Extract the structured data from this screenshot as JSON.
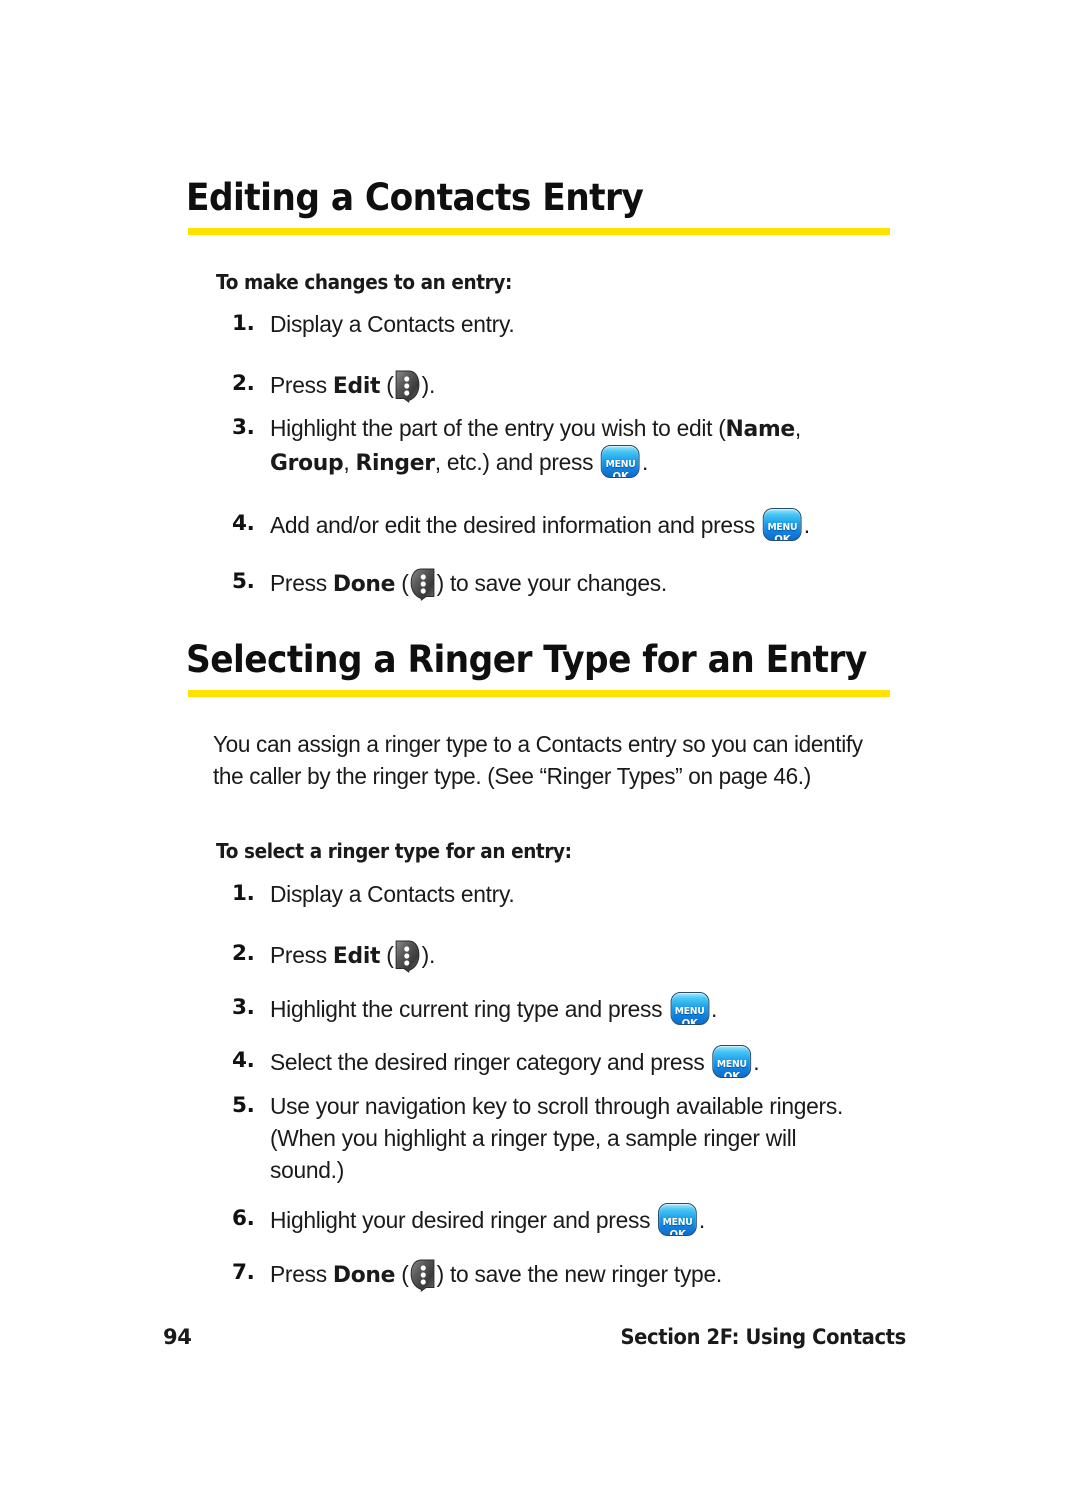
{
  "page": {
    "number": "94",
    "section_footer": "Section 2F: Using Contacts",
    "accent_rule_color": "#ffe200",
    "background_color": "#ffffff"
  },
  "icons": {
    "softkey_edit": "softkey-edit-icon",
    "softkey_done": "softkey-done-icon",
    "menu_ok_top": "MENU",
    "menu_ok_bottom": "OK"
  },
  "sections": [
    {
      "heading": "Editing a Contacts Entry",
      "subheading": "To make changes to an entry:",
      "steps": [
        {
          "num": "1.",
          "text": "Display a Contacts entry."
        },
        {
          "num": "2.",
          "text": "Press Edit (  )."
        },
        {
          "num": "3.",
          "text": "Highlight the part of the entry you wish to edit (Name, Group, Ringer, etc.) and press   ."
        },
        {
          "num": "4.",
          "text": "Add and/or edit the desired information and press   ."
        },
        {
          "num": "5.",
          "text": "Press Done (  ) to save your changes."
        }
      ]
    },
    {
      "heading": "Selecting a Ringer Type for an Entry",
      "paragraph": "You  can assign a ringer type to a Contacts entry so you can identify the caller by the ringer type. (See “Ringer Types” on page 46.)",
      "subheading": "To select a ringer type for an entry:",
      "steps": [
        {
          "num": "1.",
          "text": "Display a Contacts entry."
        },
        {
          "num": "2.",
          "text": "Press Edit (  )."
        },
        {
          "num": "3.",
          "text": "Highlight the current ring type and press   ."
        },
        {
          "num": "4.",
          "text": "Select the desired ringer category and press   ."
        },
        {
          "num": "5.",
          "text": "Use your navigation key to scroll through available ringers. (When you highlight a ringer type, a sample ringer will sound.)"
        },
        {
          "num": "6.",
          "text": "Highlight your desired ringer and press   ."
        },
        {
          "num": "7.",
          "text": "Press Done (  ) to save the new ringer type."
        }
      ]
    }
  ],
  "text_fragments": {
    "s1_step1": "Display a Contacts entry.",
    "s1_step2_a": "Press ",
    "s1_step2_b": "Edit",
    "s1_step2_open": " (",
    "s1_step2_close": ").",
    "s1_step3_a": "Highlight the part of the entry you wish to edit (",
    "s1_step3_name": "Name",
    "s1_step3_b": ", ",
    "s1_step3_group": "Group",
    "s1_step3_c": ", ",
    "s1_step3_ringer": "Ringer",
    "s1_step3_d": ", etc.) and press ",
    "s1_step3_e": ".",
    "s1_step4_a": "Add and/or edit the desired information and press ",
    "s1_step4_b": ".",
    "s1_step5_a": "Press ",
    "s1_step5_b": "Done",
    "s1_step5_open": " (",
    "s1_step5_close": ") to save your changes.",
    "s2_para": "You  can assign a ringer type to a Contacts entry so you can identify the caller by the ringer type. (See “Ringer Types” on page 46.)",
    "s2_step1": "Display a Contacts entry.",
    "s2_step2_a": "Press ",
    "s2_step2_b": "Edit",
    "s2_step2_open": " (",
    "s2_step2_close": ").",
    "s2_step3_a": "Highlight the current ring type and press ",
    "s2_step3_b": ".",
    "s2_step4_a": "Select the desired ringer category and press ",
    "s2_step4_b": ".",
    "s2_step5": "Use your navigation key to scroll through available ringers. (When you highlight a ringer type, a sample ringer will sound.)",
    "s2_step6_a": "Highlight your desired ringer and press ",
    "s2_step6_b": ".",
    "s2_step7_a": "Press ",
    "s2_step7_b": "Done",
    "s2_step7_open": " (",
    "s2_step7_close": ") to save the new ringer type."
  },
  "numbers": {
    "n1": "1.",
    "n2": "2.",
    "n3": "3.",
    "n4": "4.",
    "n5": "5.",
    "n6": "6.",
    "n7": "7."
  }
}
